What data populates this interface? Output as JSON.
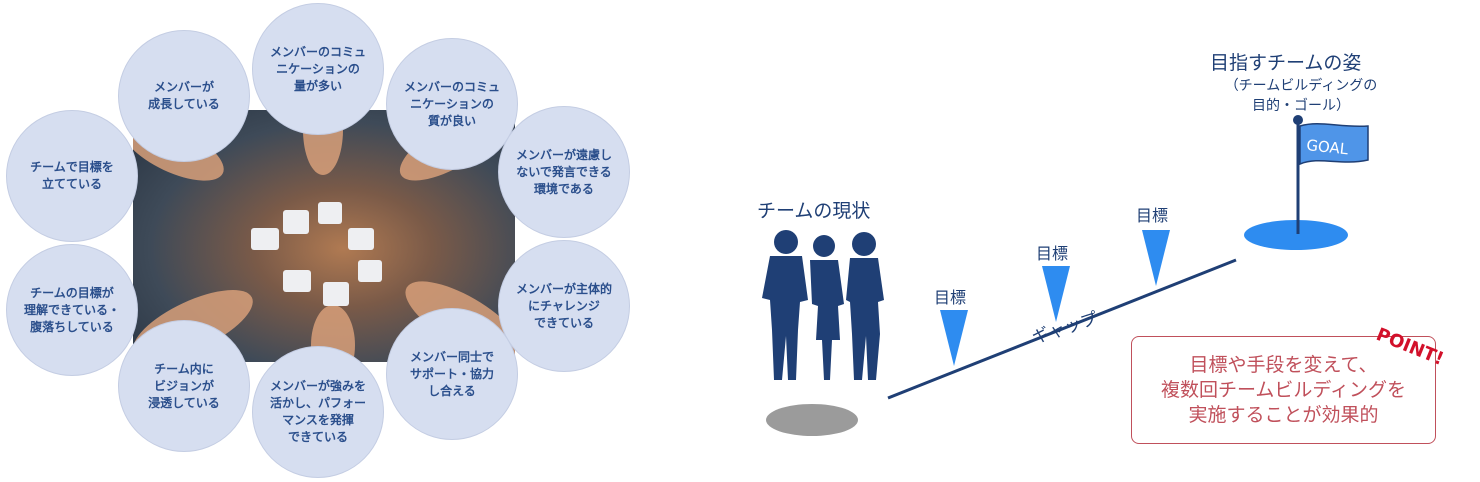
{
  "left_diagram": {
    "bubbles": [
      {
        "text": "メンバーのコミュ\nニケーションの\n量が多い"
      },
      {
        "text": "メンバーのコミュ\nニケーションの\n質が良い"
      },
      {
        "text": "メンバーが遠慮し\nないで発言できる\n環境である"
      },
      {
        "text": "メンバーが主体的\nにチャレンジ\nできている"
      },
      {
        "text": "メンバー同士で\nサポート・協力\nし合える"
      },
      {
        "text": "メンバーが強みを\n活かし、パフォー\nマンスを発揮\nできている"
      },
      {
        "text": "チーム内に\nビジョンが\n浸透している"
      },
      {
        "text": "チームの目標が\n理解できている・\n腹落ちしている"
      },
      {
        "text": "チームで目標を\n立てている"
      },
      {
        "text": "メンバーが\n成長している"
      }
    ]
  },
  "right_diagram": {
    "current_label": "チームの現状",
    "goal_title": "目指すチームの姿",
    "goal_subtitle": "（チームビルディングの\n目的・ゴール）",
    "flag_text": "GOAL",
    "targets": [
      "目標",
      "目標",
      "目標"
    ],
    "gap_label": "ギャップ",
    "point_badge": "POINT!",
    "point_text": "目標や手段を変えて、\n複数回チームビルディングを\n実施することが効果的"
  },
  "colors": {
    "bubble_fill": "#d6def0",
    "bubble_text": "#2b4f8c",
    "navy": "#1f3f75",
    "triangle_blue": "#2e8cf0",
    "goal_blue": "#2e8cf0",
    "shadow_gray": "#9b9b9b",
    "point_red": "#c0505b"
  }
}
